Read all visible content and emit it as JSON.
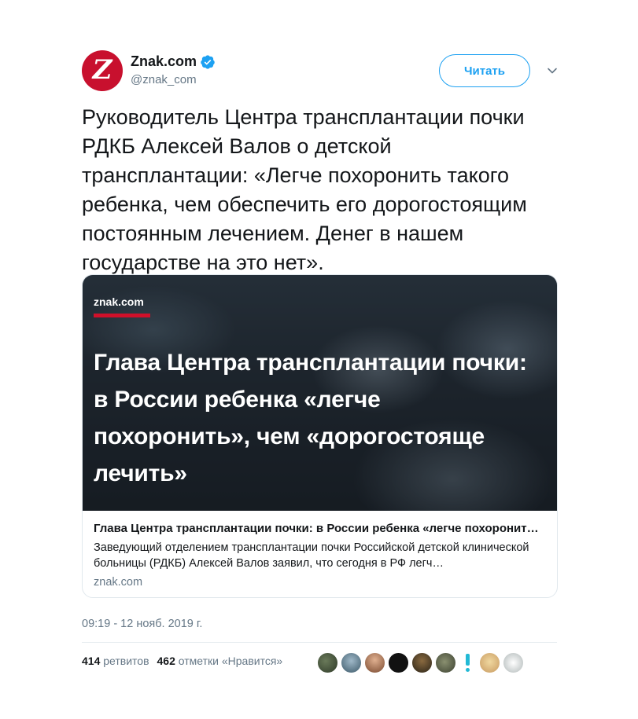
{
  "account": {
    "avatar_letter": "Z",
    "display_name": "Znak.com",
    "handle": "@znak_com",
    "follow_label": "Читать"
  },
  "tweet": {
    "text": "Руководитель Центра трансплантации почки РДКБ Алексей Валов о детской трансплантации: «Легче похоронить такого ребенка, чем обеспечить его дорогостоящим постоянным лечением. Денег в нашем государстве на это нет»."
  },
  "card": {
    "image_logo": "znak.com",
    "image_headline": "Глава Центра трансплантации почки: в России ребенка «легче похоронить», чем «дорогостояще лечить»",
    "title": "Глава Центра трансплантации почки: в России ребенка «легче похоронит…",
    "description": "Заведующий отделением трансплантации почки Российской детской клинической больницы (РДКБ) Алексей Валов заявил, что сегодня в РФ легч…",
    "domain": "znak.com"
  },
  "timestamp": "09:19 - 12 нояб. 2019 г.",
  "stats": {
    "retweets_count": "414",
    "retweets_label": "ретвитов",
    "likes_count": "462",
    "likes_label": "отметки «Нравится»"
  },
  "colors": {
    "brand_red": "#c8102e",
    "twitter_blue": "#1da1f2",
    "secondary_text": "#657786"
  },
  "icons": {
    "verified": "verified-badge-icon",
    "caret": "chevron-down-icon"
  }
}
